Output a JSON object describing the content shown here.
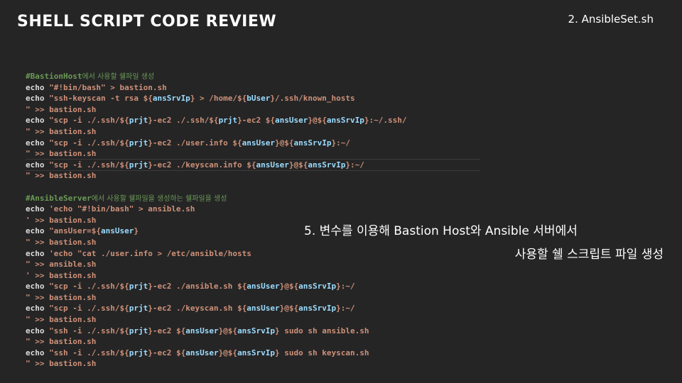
{
  "header": {
    "title": "SHELL SCRIPT CODE REVIEW",
    "file_label": "2. AnsibleSet.sh"
  },
  "notes": {
    "line1": "5. 변수를 이용해 Bastion Host와 Ansible 서버에서",
    "line2": "사용할 쉘 스크립트 파일 생성"
  },
  "colors": {
    "background": "#252526",
    "comment": "#6a9955",
    "string": "#ce9178",
    "variable": "#9cdcfe",
    "keyword": "#dcdcdc"
  },
  "code_lines": [
    [
      {
        "t": "c",
        "v": "#BastionHost"
      },
      {
        "t": "ck",
        "v": "에서 사용할 쉘파일 생성"
      }
    ],
    [
      {
        "t": "k",
        "v": "echo "
      },
      {
        "t": "s",
        "v": "\"#!bin/bash\" > bastion.sh"
      }
    ],
    [
      {
        "t": "k",
        "v": "echo "
      },
      {
        "t": "s",
        "v": "\"ssh-keyscan -t rsa ${"
      },
      {
        "t": "v",
        "v": "ansSrvIp"
      },
      {
        "t": "s",
        "v": "} > /home/${"
      },
      {
        "t": "v",
        "v": "bUser"
      },
      {
        "t": "s",
        "v": "}/.ssh/known_hosts"
      }
    ],
    [
      {
        "t": "s",
        "v": "\" >> bastion.sh"
      }
    ],
    [
      {
        "t": "k",
        "v": "echo "
      },
      {
        "t": "s",
        "v": "\"scp -i ./.ssh/${"
      },
      {
        "t": "v",
        "v": "prjt"
      },
      {
        "t": "s",
        "v": "}-ec2 ./.ssh/${"
      },
      {
        "t": "v",
        "v": "prjt"
      },
      {
        "t": "s",
        "v": "}-ec2 ${"
      },
      {
        "t": "v",
        "v": "ansUser"
      },
      {
        "t": "s",
        "v": "}@${"
      },
      {
        "t": "v",
        "v": "ansSrvIp"
      },
      {
        "t": "s",
        "v": "}:~/.ssh/"
      }
    ],
    [
      {
        "t": "s",
        "v": "\" >> bastion.sh"
      }
    ],
    [
      {
        "t": "k",
        "v": "echo "
      },
      {
        "t": "s",
        "v": "\"scp -i ./.ssh/${"
      },
      {
        "t": "v",
        "v": "prjt"
      },
      {
        "t": "s",
        "v": "}-ec2 ./user.info ${"
      },
      {
        "t": "v",
        "v": "ansUser"
      },
      {
        "t": "s",
        "v": "}@${"
      },
      {
        "t": "v",
        "v": "ansSrvIp"
      },
      {
        "t": "s",
        "v": "}:~/"
      }
    ],
    [
      {
        "t": "s",
        "v": "\" >> bastion.sh"
      }
    ],
    [
      {
        "t": "k",
        "v": "echo "
      },
      {
        "t": "s",
        "v": "\"scp -i ./.ssh/${"
      },
      {
        "t": "v",
        "v": "prjt"
      },
      {
        "t": "s",
        "v": "}-ec2 ./keyscan.info ${"
      },
      {
        "t": "v",
        "v": "ansUser"
      },
      {
        "t": "s",
        "v": "}@${"
      },
      {
        "t": "v",
        "v": "ansSrvIp"
      },
      {
        "t": "s",
        "v": "}:~/"
      }
    ],
    [
      {
        "t": "s",
        "v": "\" >> bastion.sh"
      }
    ],
    [],
    [
      {
        "t": "c",
        "v": "#AnsibleServer"
      },
      {
        "t": "ck",
        "v": "에서 사용할 쉘파일을 생성하는 쉘파일을 생성"
      }
    ],
    [
      {
        "t": "k",
        "v": "echo "
      },
      {
        "t": "s",
        "v": "'echo \"#!bin/bash\" > ansible.sh"
      }
    ],
    [
      {
        "t": "s",
        "v": "' >> bastion.sh"
      }
    ],
    [
      {
        "t": "k",
        "v": "echo "
      },
      {
        "t": "s",
        "v": "\"ansUser=${"
      },
      {
        "t": "v",
        "v": "ansUser"
      },
      {
        "t": "s",
        "v": "}"
      }
    ],
    [
      {
        "t": "s",
        "v": "\" >> bastion.sh"
      }
    ],
    [
      {
        "t": "k",
        "v": "echo "
      },
      {
        "t": "s",
        "v": "'echo \"cat ./user.info > /etc/ansible/hosts"
      }
    ],
    [
      {
        "t": "s",
        "v": "\" >> ansible.sh"
      }
    ],
    [
      {
        "t": "s",
        "v": "' >> bastion.sh"
      }
    ],
    [
      {
        "t": "k",
        "v": "echo "
      },
      {
        "t": "s",
        "v": "\"scp -i ./.ssh/${"
      },
      {
        "t": "v",
        "v": "prjt"
      },
      {
        "t": "s",
        "v": "}-ec2 ./ansible.sh ${"
      },
      {
        "t": "v",
        "v": "ansUser"
      },
      {
        "t": "s",
        "v": "}@${"
      },
      {
        "t": "v",
        "v": "ansSrvIp"
      },
      {
        "t": "s",
        "v": "}:~/"
      }
    ],
    [
      {
        "t": "s",
        "v": "\" >> bastion.sh"
      }
    ],
    [
      {
        "t": "k",
        "v": "echo "
      },
      {
        "t": "s",
        "v": "\"scp -i ./.ssh/${"
      },
      {
        "t": "v",
        "v": "prjt"
      },
      {
        "t": "s",
        "v": "}-ec2 ./keyscan.sh ${"
      },
      {
        "t": "v",
        "v": "ansUser"
      },
      {
        "t": "s",
        "v": "}@${"
      },
      {
        "t": "v",
        "v": "ansSrvIp"
      },
      {
        "t": "s",
        "v": "}:~/"
      }
    ],
    [
      {
        "t": "s",
        "v": "\" >> bastion.sh"
      }
    ],
    [
      {
        "t": "k",
        "v": "echo "
      },
      {
        "t": "s",
        "v": "\"ssh -i ./.ssh/${"
      },
      {
        "t": "v",
        "v": "prjt"
      },
      {
        "t": "s",
        "v": "}-ec2 ${"
      },
      {
        "t": "v",
        "v": "ansUser"
      },
      {
        "t": "s",
        "v": "}@${"
      },
      {
        "t": "v",
        "v": "ansSrvIp"
      },
      {
        "t": "s",
        "v": "} sudo sh ansible.sh"
      }
    ],
    [
      {
        "t": "s",
        "v": "\" >> bastion.sh"
      }
    ],
    [
      {
        "t": "k",
        "v": "echo "
      },
      {
        "t": "s",
        "v": "\"ssh -i ./.ssh/${"
      },
      {
        "t": "v",
        "v": "prjt"
      },
      {
        "t": "s",
        "v": "}-ec2 ${"
      },
      {
        "t": "v",
        "v": "ansUser"
      },
      {
        "t": "s",
        "v": "}@${"
      },
      {
        "t": "v",
        "v": "ansSrvIp"
      },
      {
        "t": "s",
        "v": "} sudo sh keyscan.sh"
      }
    ],
    [
      {
        "t": "s",
        "v": "\" >> bastion.sh"
      }
    ]
  ]
}
